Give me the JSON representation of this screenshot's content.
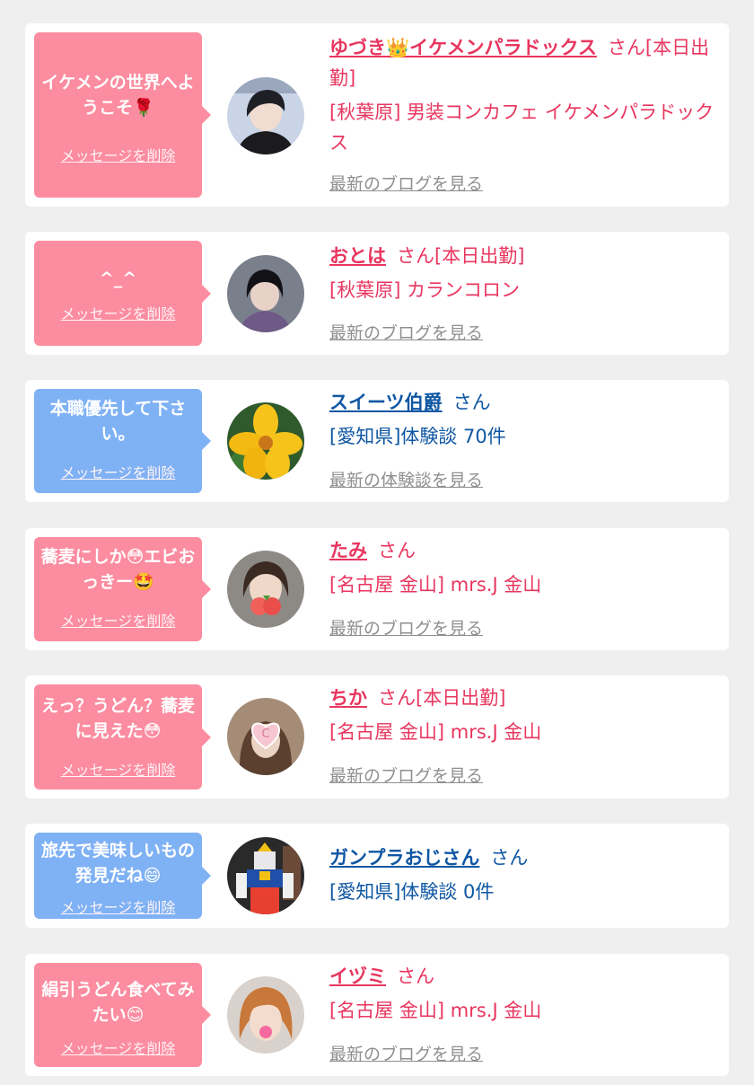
{
  "delete_label": "メッセージを削除",
  "colors": {
    "pink_bubble": "#fc8ca0",
    "blue_bubble": "#7fb1f5",
    "pink_text": "#e8365f",
    "blue_text": "#0f57a3"
  },
  "entries": [
    {
      "message": "イケメンの世界へようこそ🌹",
      "name": "ゆづき👑イケメンパラドックス",
      "honorific": "さん",
      "status": "[本日出勤]",
      "shop": "[秋葉原] 男装コンカフェ イケメンパラドックス",
      "link": "最新のブログを見る",
      "avatar_icon": "person-dark-hair-avatar"
    },
    {
      "message": "^_^",
      "name": "おとは",
      "honorific": "さん",
      "status": "[本日出勤]",
      "shop": "[秋葉原] カランコロン",
      "link": "最新のブログを見る",
      "avatar_icon": "person-black-bob-avatar"
    },
    {
      "message": "本職優先して下さい。",
      "name": "スイーツ伯爵",
      "honorific": "さん",
      "status": "",
      "shop": "[愛知県]体験談 70件",
      "link": "最新の体験談を見る",
      "avatar_icon": "yellow-flower-avatar"
    },
    {
      "message": "蕎麦にしか😳エビおっきー🤩",
      "name": "たみ",
      "honorific": "さん",
      "status": "",
      "shop": "[名古屋 金山] mrs.J 金山",
      "link": "最新のブログを見る",
      "avatar_icon": "person-peach-sticker-avatar"
    },
    {
      "message": "えっ？うどん？蕎麦に見えた😳",
      "name": "ちか",
      "honorific": "さん",
      "status": "[本日出勤]",
      "shop": "[名古屋 金山] mrs.J 金山",
      "link": "最新のブログを見る",
      "avatar_icon": "person-heart-sticker-avatar"
    },
    {
      "message": "旅先で美味しいもの発見だね😄",
      "name": "ガンプラおじさん",
      "honorific": "さん",
      "status": "",
      "shop": "[愛知県]体験談 0件",
      "link": "",
      "avatar_icon": "robot-model-avatar"
    },
    {
      "message": "絹引うどん食べてみたい😊",
      "name": "イヅミ",
      "honorific": "さん",
      "status": "",
      "shop": "[名古屋 金山] mrs.J 金山",
      "link": "最新のブログを見る",
      "avatar_icon": "person-orange-hair-avatar"
    }
  ]
}
